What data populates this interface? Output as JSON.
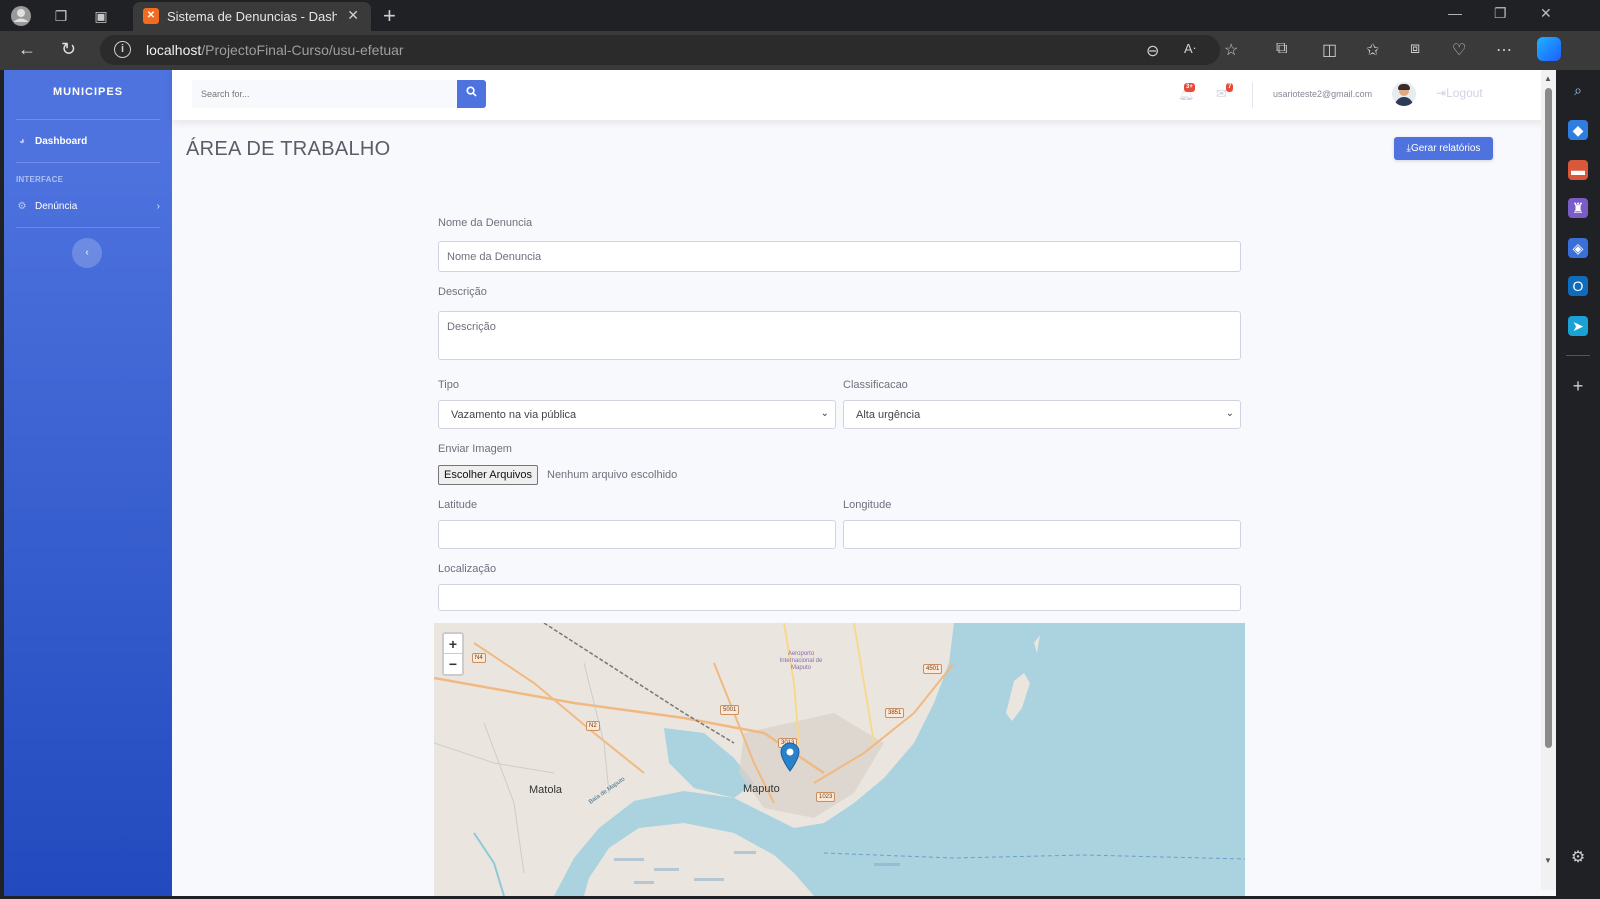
{
  "browser": {
    "tab_title": "Sistema de Denuncias - Dashboa",
    "url_host": "localhost",
    "url_path": "/ProjectoFinal-Curso/usu-efetuar"
  },
  "sidebar": {
    "brand": "MUNICIPES",
    "dashboard_label": "Dashboard",
    "interface_heading": "INTERFACE",
    "denuncia_label": "Denúncia",
    "toggle_glyph": "‹"
  },
  "topbar": {
    "search_placeholder": "Search for...",
    "alerts_badge": "3+",
    "messages_badge": "7",
    "user_email": "usarioteste2@gmail.com",
    "logout_label": "Logout"
  },
  "page": {
    "title": "ÁREA DE TRABALHO",
    "report_button": "Gerar relatórios"
  },
  "form": {
    "nome_label": "Nome da Denuncia",
    "nome_placeholder": "Nome da Denuncia",
    "descricao_label": "Descrição",
    "descricao_placeholder": "Descrição",
    "tipo_label": "Tipo",
    "tipo_value": "Vazamento na via pública",
    "classificacao_label": "Classificacao",
    "classificacao_value": "Alta urgência",
    "imagem_label": "Enviar Imagem",
    "file_button": "Escolher Arquivos",
    "file_status": "Nenhum arquivo escolhido",
    "latitude_label": "Latitude",
    "latitude_value": "",
    "longitude_label": "Longitude",
    "longitude_value": "",
    "localizacao_label": "Localização",
    "localizacao_value": ""
  },
  "map": {
    "zoom_in": "+",
    "zoom_out": "−",
    "labels": {
      "matola": "Matola",
      "maputo": "Maputo",
      "airport": "Aeroporto Internacional de Maputo",
      "baia": "Baía de Maputo"
    },
    "shields": [
      "N4",
      "N2",
      "5001",
      "3013",
      "3851",
      "4501",
      "1023"
    ],
    "colors": {
      "water": "#aad3df",
      "land": "#eae6df",
      "marker": "#2a81cb"
    }
  },
  "colors": {
    "primary": "#4e73df",
    "sidebar_gradient_end": "#224abe",
    "badge": "#e74a3b"
  }
}
